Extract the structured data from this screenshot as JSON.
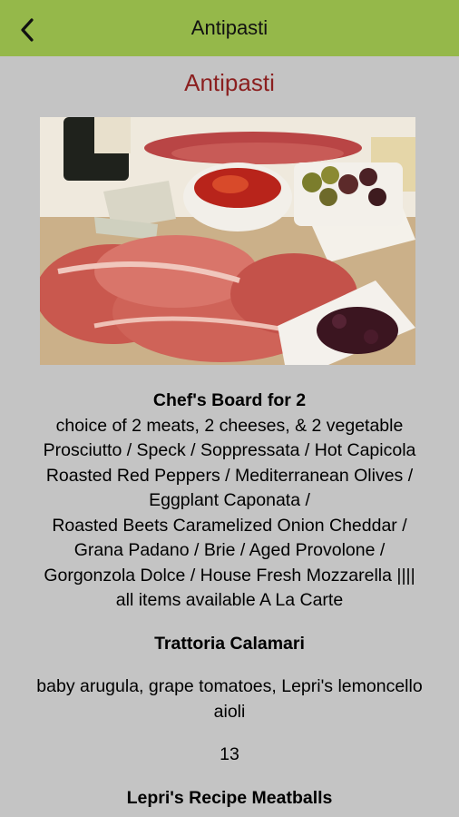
{
  "header": {
    "title": "Antipasti",
    "back_icon": "chevron-left-icon"
  },
  "section": {
    "title": "Antipasti"
  },
  "items": [
    {
      "name": "Chef's Board for 2",
      "lines": [
        "choice of 2 meats, 2 cheeses, & 2 vegetable",
        "Prosciutto / Speck / Soppressata / Hot Capicola",
        "Roasted Red Peppers / Mediterranean Olives /",
        "Eggplant Caponata /",
        "Roasted Beets Caramelized Onion Cheddar /",
        "Grana Padano / Brie / Aged Provolone /",
        "Gorgonzola Dolce / House Fresh Mozzarella ||||",
        "all items available A La Carte"
      ]
    },
    {
      "name": "Trattoria Calamari",
      "lines": [
        "baby arugula, grape tomatoes, Lepri's lemoncello",
        "aioli"
      ],
      "price": "13"
    },
    {
      "name": "Lepri's Recipe Meatballs"
    }
  ],
  "colors": {
    "header_bg": "#95b84a",
    "page_bg": "#c4c4c4",
    "section_title": "#8b1f1f"
  }
}
